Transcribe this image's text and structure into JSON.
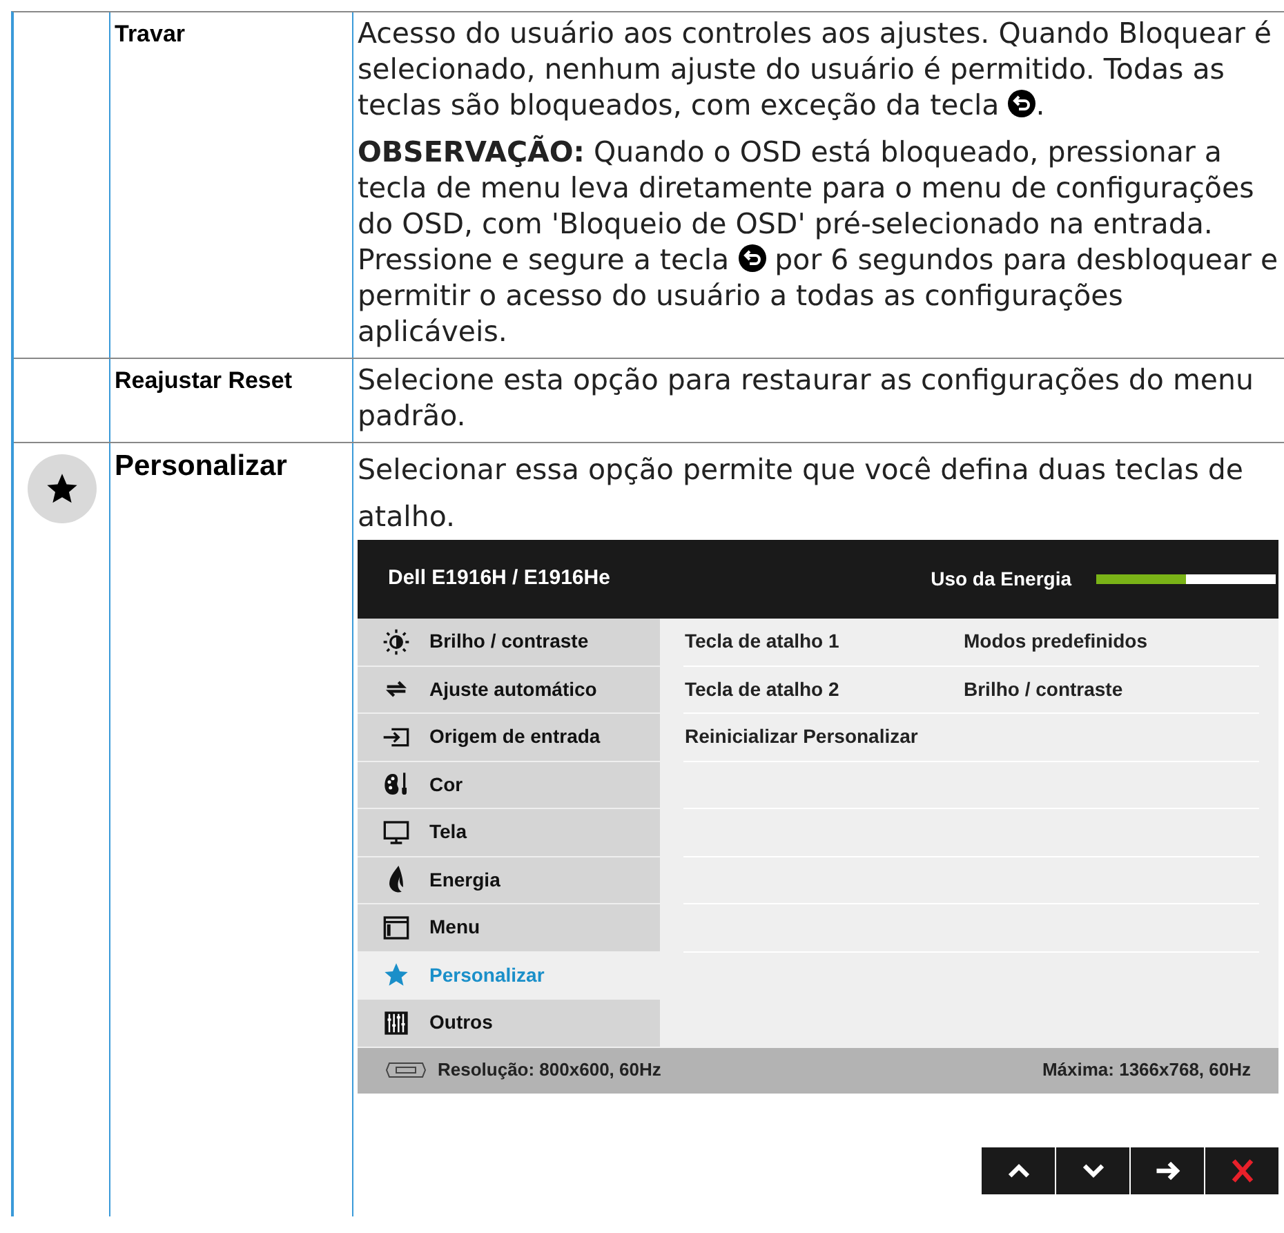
{
  "rows": [
    {
      "kind": "plain",
      "label": "Travar",
      "paragraphs": [
        [
          {
            "kind": "text",
            "text": "Acesso do usuário aos controles aos ajustes. Quando Bloquear é selecionado, nenhum ajuste do usuário é permitido. Todas as teclas são bloqueados, com exceção da tecla "
          },
          {
            "kind": "back-key"
          },
          {
            "kind": "text",
            "text": "."
          }
        ],
        [
          {
            "kind": "text",
            "text": "**OBSERVAÇÃO:** Quando o OSD está bloqueado, pressionar a tecla de menu leva diretamente para o menu de configurações do OSD, com 'Bloqueio de OSD' pré-selecionado na entrada. Pressione e segure a tecla "
          },
          {
            "kind": "back-key"
          },
          {
            "kind": "text",
            "text": " por 6 segundos para desbloquear e permitir o acesso do usuário a todas as configurações aplicáveis."
          }
        ]
      ]
    },
    {
      "kind": "plain",
      "label": "Reajustar Reset",
      "paragraphs": [
        [
          {
            "kind": "text",
            "text": "Selecione esta opção para restaurar as configurações do menu padrão."
          }
        ]
      ]
    },
    {
      "kind": "star",
      "label": "Personalizar",
      "paragraphs": [
        [
          {
            "kind": "text",
            "text": "Selecionar essa opção permite que você deﬁna duas teclas de atalho."
          }
        ]
      ],
      "osd": {
        "title": "Dell E1916H / E1916He",
        "energy_label": "Uso da Energia",
        "energy": {
          "level": 0.5
        },
        "menu": [
          {
            "kind": "brightness",
            "label": "Brilho / contraste",
            "selected": false
          },
          {
            "kind": "auto",
            "label": "Ajuste automático",
            "selected": false
          },
          {
            "kind": "input",
            "label": "Origem de entrada",
            "selected": false
          },
          {
            "kind": "color",
            "label": "Cor",
            "selected": false
          },
          {
            "kind": "display",
            "label": "Tela",
            "selected": false
          },
          {
            "kind": "energy",
            "label": "Energia",
            "selected": false
          },
          {
            "kind": "menu",
            "label": "Menu",
            "selected": false
          },
          {
            "kind": "star",
            "label": "Personalizar",
            "selected": true
          },
          {
            "kind": "others",
            "label": "Outros",
            "selected": false
          }
        ],
        "options": [
          {
            "label": "Tecla de atalho 1",
            "value": "Modos predefinidos"
          },
          {
            "label": "Tecla de atalho 2",
            "value": "Brilho / contraste"
          },
          {
            "label": "Reinicializar Personalizar"
          }
        ],
        "resolution": "Resolução: 800x600, 60Hz",
        "maximum": "Máxima: 1366x768, 60Hz",
        "buttons": [
          {
            "kind": "up"
          },
          {
            "kind": "down"
          },
          {
            "kind": "right"
          },
          {
            "kind": "close"
          }
        ]
      }
    }
  ]
}
